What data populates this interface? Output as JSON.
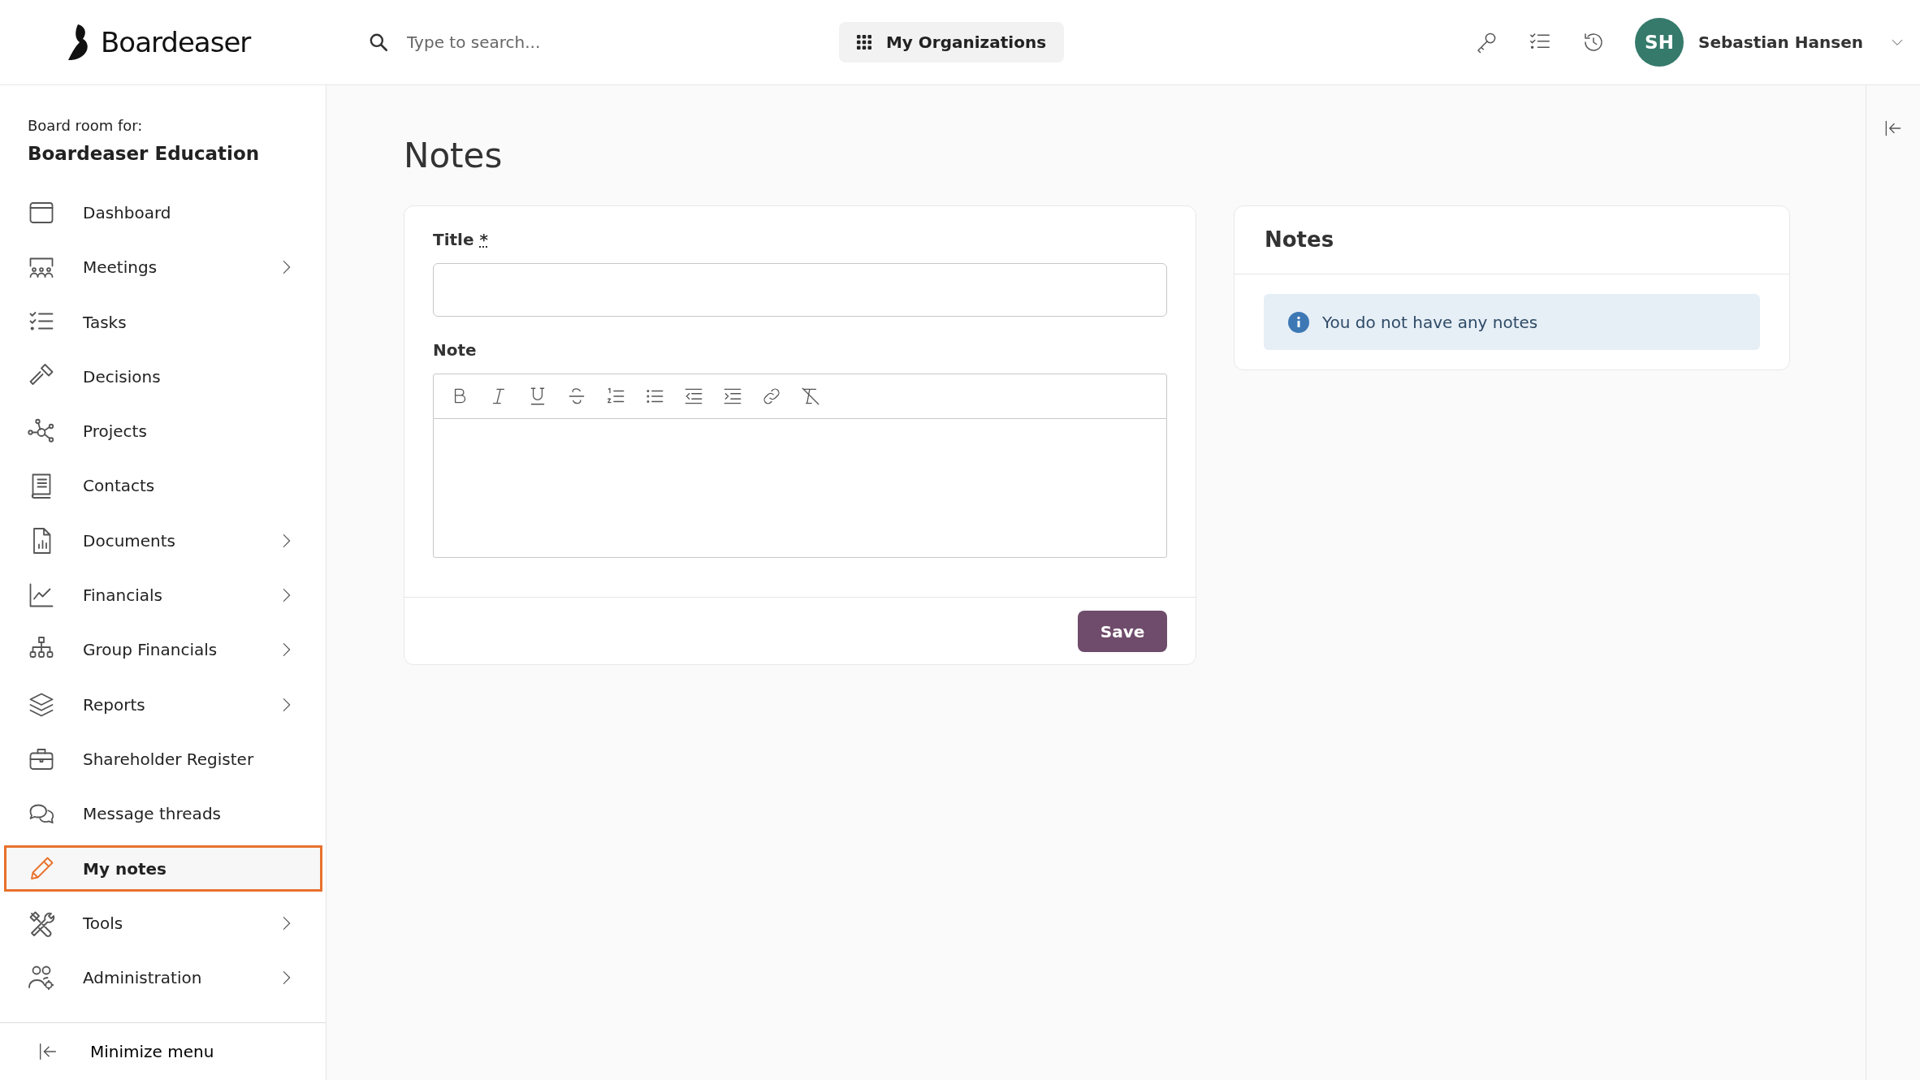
{
  "header": {
    "logo_text": "Boardeaser",
    "search": {
      "placeholder": "Type to search..."
    },
    "org_button": "My Organizations",
    "user": {
      "initials": "SH",
      "name": "Sebastian Hansen"
    }
  },
  "sidebar": {
    "caption": "Board room for:",
    "organization": "Boardeaser Education",
    "items": [
      {
        "label": "Dashboard",
        "has_submenu": false,
        "selected": false
      },
      {
        "label": "Meetings",
        "has_submenu": true,
        "selected": false
      },
      {
        "label": "Tasks",
        "has_submenu": false,
        "selected": false
      },
      {
        "label": "Decisions",
        "has_submenu": false,
        "selected": false
      },
      {
        "label": "Projects",
        "has_submenu": false,
        "selected": false
      },
      {
        "label": "Contacts",
        "has_submenu": false,
        "selected": false
      },
      {
        "label": "Documents",
        "has_submenu": true,
        "selected": false
      },
      {
        "label": "Financials",
        "has_submenu": true,
        "selected": false
      },
      {
        "label": "Group Financials",
        "has_submenu": true,
        "selected": false
      },
      {
        "label": "Reports",
        "has_submenu": true,
        "selected": false
      },
      {
        "label": "Shareholder Register",
        "has_submenu": false,
        "selected": false
      },
      {
        "label": "Message threads",
        "has_submenu": false,
        "selected": false
      },
      {
        "label": "My notes",
        "has_submenu": false,
        "selected": true
      },
      {
        "label": "Tools",
        "has_submenu": true,
        "selected": false
      },
      {
        "label": "Administration",
        "has_submenu": true,
        "selected": false
      }
    ],
    "minimize": "Minimize menu"
  },
  "page": {
    "title": "Notes",
    "form": {
      "title_label": "Title",
      "required_mark": "*",
      "note_label": "Note",
      "save_button": "Save"
    },
    "notes_panel": {
      "heading": "Notes",
      "empty_message": "You do not have any notes"
    }
  }
}
